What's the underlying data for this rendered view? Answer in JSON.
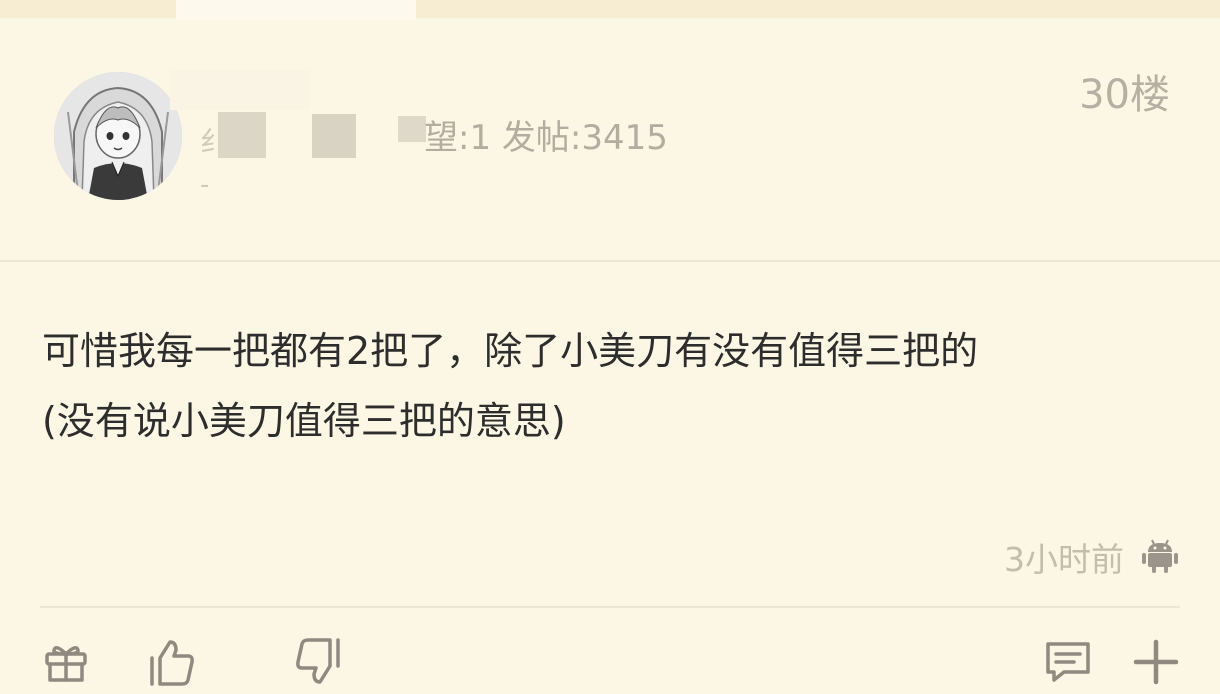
{
  "post": {
    "floor": "30楼",
    "author": {
      "stats": "望:1 发帖:3415",
      "level_fragment": "纟",
      "dash_fragment": "-"
    },
    "content_lines": [
      "可惜我每一把都有2把了，除了小美刀有没有值得三把的",
      "(没有说小美刀值得三把的意思)"
    ],
    "time": "3小时前",
    "platform_icon": "android-icon"
  },
  "actions": {
    "gift_icon": "gift-icon",
    "like_icon": "thumbs-up-icon",
    "dislike_icon": "thumbs-down-icon",
    "comment_icon": "comment-icon",
    "more_icon": "plus-icon"
  },
  "colors": {
    "background": "#fcf6e5",
    "text_primary": "#2d2d2d",
    "text_muted": "#b6b0a2",
    "divider": "#ede6d2",
    "icon": "#8f8a7f"
  }
}
